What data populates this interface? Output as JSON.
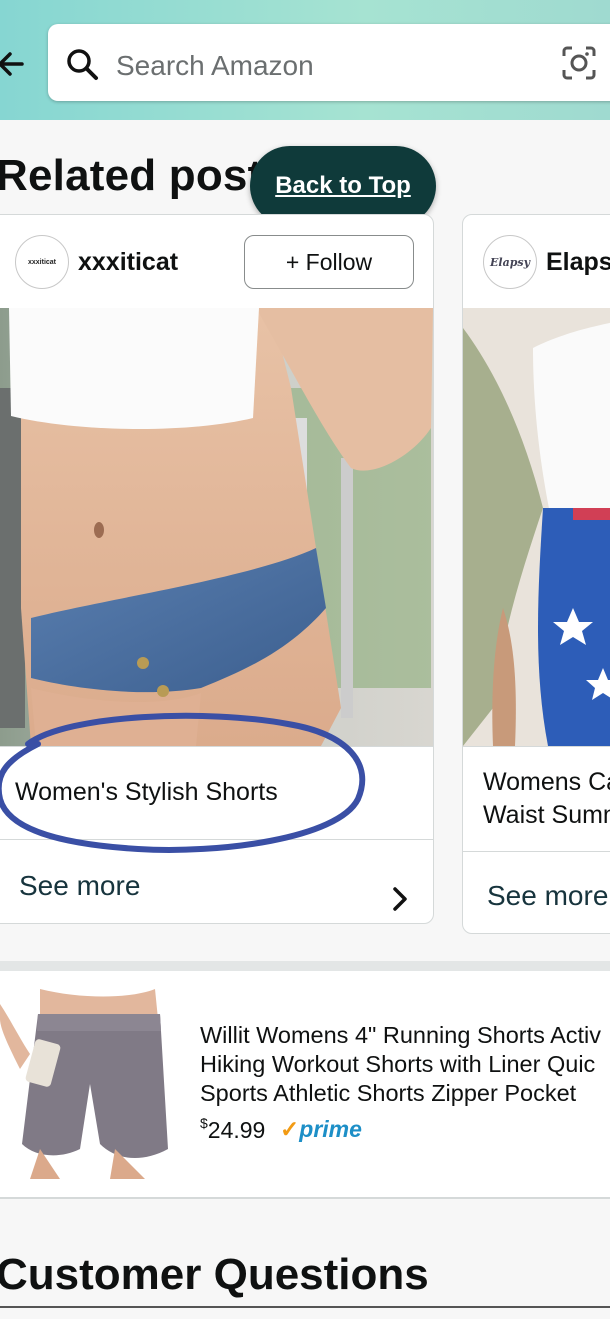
{
  "header": {
    "search_placeholder": "Search Amazon"
  },
  "section": {
    "title": "Related posts"
  },
  "back_to_top": "Back to Top",
  "posts": [
    {
      "avatar_text": "xxxiticat",
      "username": "xxxiticat",
      "follow_label": "+ Follow",
      "caption": "Women's Stylish Shorts",
      "see_more": "See more"
    },
    {
      "avatar_text": "Elapsy",
      "username": "Elapsy",
      "caption_line1": "Womens Ca",
      "caption_line2": "Waist Summ",
      "see_more": "See more"
    }
  ],
  "product": {
    "title_line1": "Willit Womens 4\" Running Shorts Activ",
    "title_line2": "Hiking Workout Shorts with Liner Quic",
    "title_line3": "Sports Athletic Shorts Zipper Pocket",
    "currency": "$",
    "price": "24.99",
    "badge": "prime"
  },
  "customer_questions": {
    "title": "Customer Questions"
  },
  "colors": {
    "header_teal": "#8fdbd4",
    "back_to_top_bg": "#0f3a3a",
    "prime_blue": "#1d8fc7",
    "prime_check": "#f29b14"
  },
  "icons": [
    "back-arrow-icon",
    "search-icon",
    "camera-lens-icon",
    "chevron-right-icon"
  ]
}
